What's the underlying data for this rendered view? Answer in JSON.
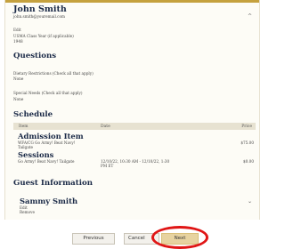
{
  "contact": {
    "name": "John Smith",
    "email": "john.smith@youremail.com",
    "field1_label": "Edit",
    "field2_label": "USMA Class Year (if applicable)",
    "field2_value": "1948"
  },
  "questions": {
    "title": "Questions",
    "q1_label": "Dietary Restrictions (Check all that apply)",
    "q1_value": "None",
    "q2_label": "Special Needs (Check all that apply)",
    "q2_value": "None"
  },
  "schedule": {
    "title": "Schedule",
    "columns": [
      "Item",
      "Date",
      "Price"
    ],
    "admission": {
      "title": "Admission Item",
      "sub1": "WFA/CG Go Army! Beat Navy!",
      "sub2": "Tailgate",
      "price": "$75.00"
    },
    "sessions": {
      "title": "Sessions",
      "sub1": "Go Army! Beat Navy! Tailgate",
      "date1": "12/10/22, 10:30 AM - 12/10/22, 1:30",
      "date2": "PM ET",
      "price": "$0.00"
    }
  },
  "guest": {
    "title": "Guest Information",
    "name": "Sammy Smith",
    "field1_label": "Edit",
    "field1_value": "Remove"
  },
  "footer": {
    "previous_label": "Previous",
    "cancel_label": "Cancel",
    "next_label": "Next"
  },
  "colors": {
    "accent_gold": "#c5a13e",
    "heading_navy": "#1b2a47",
    "highlight_red": "#e01616"
  }
}
